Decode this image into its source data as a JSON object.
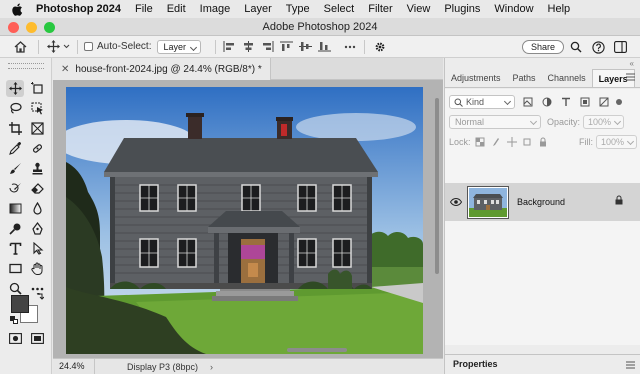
{
  "menubar": {
    "app_name": "Photoshop 2024",
    "items": [
      "File",
      "Edit",
      "Image",
      "Layer",
      "Type",
      "Select",
      "Filter",
      "View",
      "Plugins",
      "Window",
      "Help"
    ]
  },
  "window": {
    "title": "Adobe Photoshop 2024",
    "traffic_light_colors": [
      "#ff5f57",
      "#febc2e",
      "#28c840"
    ]
  },
  "options_bar": {
    "auto_select_label": "Auto-Select:",
    "auto_select_checked": false,
    "auto_select_target": "Layer",
    "share_label": "Share",
    "icons": [
      "home-icon",
      "move-tool-icon",
      "align-left-icon",
      "align-center-h-icon",
      "align-right-icon",
      "align-top-icon",
      "align-middle-icon",
      "align-bottom-icon",
      "more-icon",
      "settings-icon",
      "search-icon",
      "help-icon",
      "workspace-icon"
    ]
  },
  "document": {
    "tab_title": "house-front-2024.jpg @ 24.4% (RGB/8*) *",
    "zoom": "24.4%",
    "color_profile": "Display P3 (8bpc)"
  },
  "toolbar": {
    "tools": [
      "move-tool",
      "artboard-tool",
      "lasso-tool",
      "object-select-tool",
      "crop-tool",
      "frame-tool",
      "eyedropper-tool",
      "spot-healing-tool",
      "brush-tool",
      "clone-stamp-tool",
      "history-brush-tool",
      "eraser-tool",
      "gradient-tool",
      "blur-tool",
      "dodge-tool",
      "pen-tool",
      "type-tool",
      "path-select-tool",
      "rectangle-tool",
      "hand-tool",
      "zoom-tool",
      "more-tools"
    ],
    "foreground_color": "#444444",
    "background_color": "#ffffff"
  },
  "panels": {
    "tabs": [
      "Adjustments",
      "Paths",
      "Channels",
      "Layers"
    ],
    "active_tab": "Layers",
    "filter_kind": "Kind",
    "blend_mode": "Normal",
    "opacity_label": "Opacity:",
    "opacity_value": "100%",
    "lock_label": "Lock:",
    "fill_label": "Fill:",
    "fill_value": "100%",
    "layers": [
      {
        "name": "Background",
        "visible": true,
        "locked": true
      }
    ],
    "properties_label": "Properties"
  }
}
